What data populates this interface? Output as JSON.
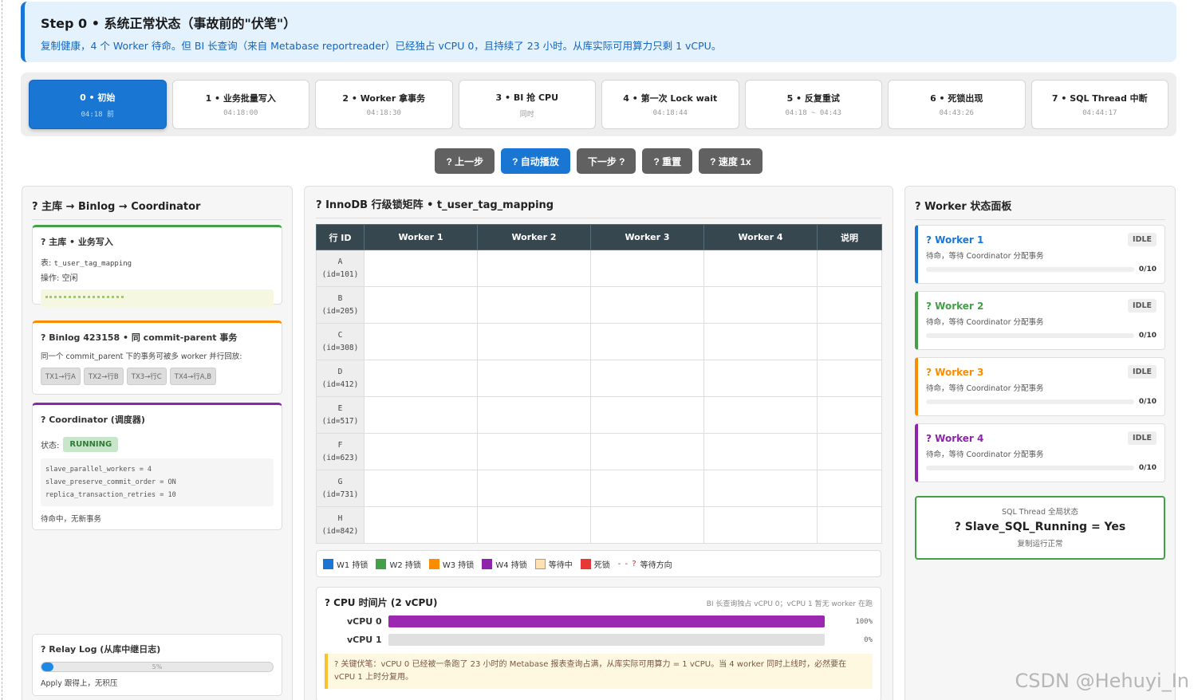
{
  "header": {
    "title": "Step 0 • 系统正常状态（事故前的\"伏笔\"）",
    "description": "复制健康，4 个 Worker 待命。但 BI 长查询（来自 Metabase reportreader）已经独占 vCPU 0，且持续了 23 小时。从库实际可用算力只剩 1 vCPU。"
  },
  "steps": [
    {
      "label": "0 • 初始",
      "time": "04:18 前",
      "active": true
    },
    {
      "label": "1 • 业务批量写入",
      "time": "04:18:00",
      "active": false
    },
    {
      "label": "2 • Worker 拿事务",
      "time": "04:18:30",
      "active": false
    },
    {
      "label": "3 • BI 抢 CPU",
      "time": "同时",
      "active": false
    },
    {
      "label": "4 • 第一次 Lock wait",
      "time": "04:18:44",
      "active": false
    },
    {
      "label": "5 • 反复重试",
      "time": "04:18 ~ 04:43",
      "active": false
    },
    {
      "label": "6 • 死锁出现",
      "time": "04:43:26",
      "active": false
    },
    {
      "label": "7 • SQL Thread 中断",
      "time": "04:44:17",
      "active": false
    }
  ],
  "controls": {
    "prev": "? 上一步",
    "autoplay": "? 自动播放",
    "next": "下一步 ?",
    "reset": "? 重置",
    "speed": "? 速度 1x"
  },
  "left": {
    "title": "? 主库 → Binlog → Coordinator",
    "master": {
      "title": "? 主库 • 业务写入",
      "table_label": "表:",
      "table_value": "t_user_tag_mapping",
      "op_label": "操作:",
      "op_value": "空闲"
    },
    "binlog": {
      "title": "? Binlog 423158 • 同 commit-parent 事务",
      "desc": "同一个 commit_parent 下的事务可被多 worker 并行回放:",
      "chips": [
        "TX1→行A",
        "TX2→行B",
        "TX3→行C",
        "TX4→行A,B"
      ]
    },
    "coordinator": {
      "title": "? Coordinator (调度器)",
      "status_label": "状态:",
      "status": "RUNNING",
      "config": [
        "slave_parallel_workers = 4",
        "slave_preserve_commit_order = ON",
        "replica_transaction_retries = 10"
      ],
      "note": "待命中，无新事务"
    },
    "relay": {
      "title": "? Relay Log (从库中继日志)",
      "percent": 5,
      "percent_text": "5%",
      "note": "Apply 跟得上，无积压"
    }
  },
  "middle": {
    "title": "? InnoDB 行级锁矩阵 • t_user_tag_mapping",
    "columns": [
      "行 ID",
      "Worker 1",
      "Worker 2",
      "Worker 3",
      "Worker 4",
      "说明"
    ],
    "rows": [
      {
        "id": "A",
        "sub": "(id=101)"
      },
      {
        "id": "B",
        "sub": "(id=205)"
      },
      {
        "id": "C",
        "sub": "(id=308)"
      },
      {
        "id": "D",
        "sub": "(id=412)"
      },
      {
        "id": "E",
        "sub": "(id=517)"
      },
      {
        "id": "F",
        "sub": "(id=623)"
      },
      {
        "id": "G",
        "sub": "(id=731)"
      },
      {
        "id": "H",
        "sub": "(id=842)"
      }
    ],
    "legend": [
      {
        "label": "W1 持锁",
        "color": "#1976d2"
      },
      {
        "label": "W2 持锁",
        "color": "#43a047"
      },
      {
        "label": "W3 持锁",
        "color": "#fb8c00"
      },
      {
        "label": "W4 持锁",
        "color": "#8e24aa"
      },
      {
        "label": "等待中",
        "color": "#ffe0b2"
      },
      {
        "label": "死锁",
        "color": "#e53935"
      }
    ],
    "legend_arrow": "- - ?",
    "legend_arrow_label": "等待方向",
    "cpu": {
      "title": "? CPU 时间片 (2 vCPU)",
      "note": "BI 长查询独占 vCPU 0；vCPU 1 暂无 worker 在跑",
      "rows": [
        {
          "label": "vCPU 0",
          "percent": 100,
          "percent_text": "100%"
        },
        {
          "label": "vCPU 1",
          "percent": 0,
          "percent_text": "0%"
        }
      ],
      "warning": "? 关键伏笔：vCPU 0 已经被一条跑了 23 小时的 Metabase 报表查询占满，从库实际可用算力 = 1 vCPU。当 4 worker 同时上线时，必然要在 vCPU 1 上时分复用。"
    }
  },
  "right": {
    "title": "? Worker 状态面板",
    "workers": [
      {
        "name": "? Worker 1",
        "status": "IDLE",
        "desc": "待命，等待 Coordinator 分配事务",
        "count": "0/10",
        "color": "#1976d2"
      },
      {
        "name": "? Worker 2",
        "status": "IDLE",
        "desc": "待命，等待 Coordinator 分配事务",
        "count": "0/10",
        "color": "#43a047"
      },
      {
        "name": "? Worker 3",
        "status": "IDLE",
        "desc": "待命，等待 Coordinator 分配事务",
        "count": "0/10",
        "color": "#fb8c00"
      },
      {
        "name": "? Worker 4",
        "status": "IDLE",
        "desc": "待命，等待 Coordinator 分配事务",
        "count": "0/10",
        "color": "#8e24aa"
      }
    ],
    "sql_thread": {
      "caption": "SQL Thread 全局状态",
      "main": "? Slave_SQL_Running = Yes",
      "sub": "复制运行正常"
    }
  },
  "watermark": "CSDN @Hehuyi_In"
}
